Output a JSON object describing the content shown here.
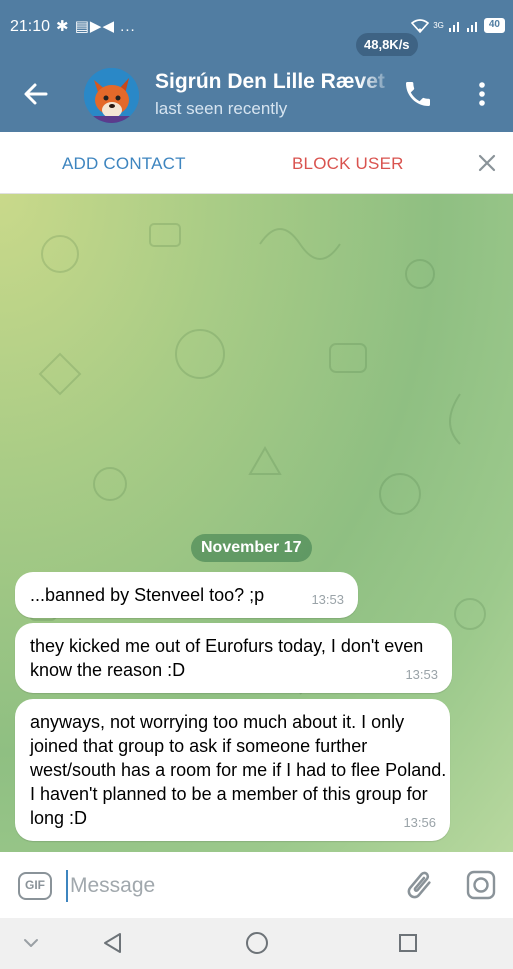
{
  "status_bar": {
    "time": "21:10",
    "left_icons": "✱ ▤▶◀ ...",
    "speed": "48,8K/s",
    "signal_1": "3G",
    "battery": "40"
  },
  "header": {
    "contact_name": "Sigrún Den Lille Rævet",
    "status": "last seen recently"
  },
  "action_bar": {
    "add_contact_label": "ADD CONTACT",
    "block_user_label": "BLOCK USER"
  },
  "chat": {
    "date": "November 17",
    "messages": [
      {
        "text": "...banned by Stenveel too? ;p",
        "time": "13:53"
      },
      {
        "text": "they kicked me out of Eurofurs today, I don't even know the reason :D",
        "time": "13:53"
      },
      {
        "text": "anyways, not worrying too much about it. I only joined that group to ask if someone further west/south has a room for me if I had to flee Poland. I haven't planned to be a member of this group for long :D",
        "time": "13:56"
      }
    ]
  },
  "input_bar": {
    "gif_label": "GIF",
    "placeholder": "Message",
    "value": ""
  },
  "colors": {
    "header_bg": "#517da2",
    "accent_blue": "#3e85bf",
    "block_red": "#d9534f",
    "chat_bg": "#a9cc86"
  },
  "icons": [
    "back-arrow-icon",
    "phone-icon",
    "more-vert-icon",
    "close-icon",
    "attach-icon",
    "camera-icon",
    "nav-down-icon",
    "nav-back-icon",
    "nav-home-icon",
    "nav-recent-icon"
  ]
}
